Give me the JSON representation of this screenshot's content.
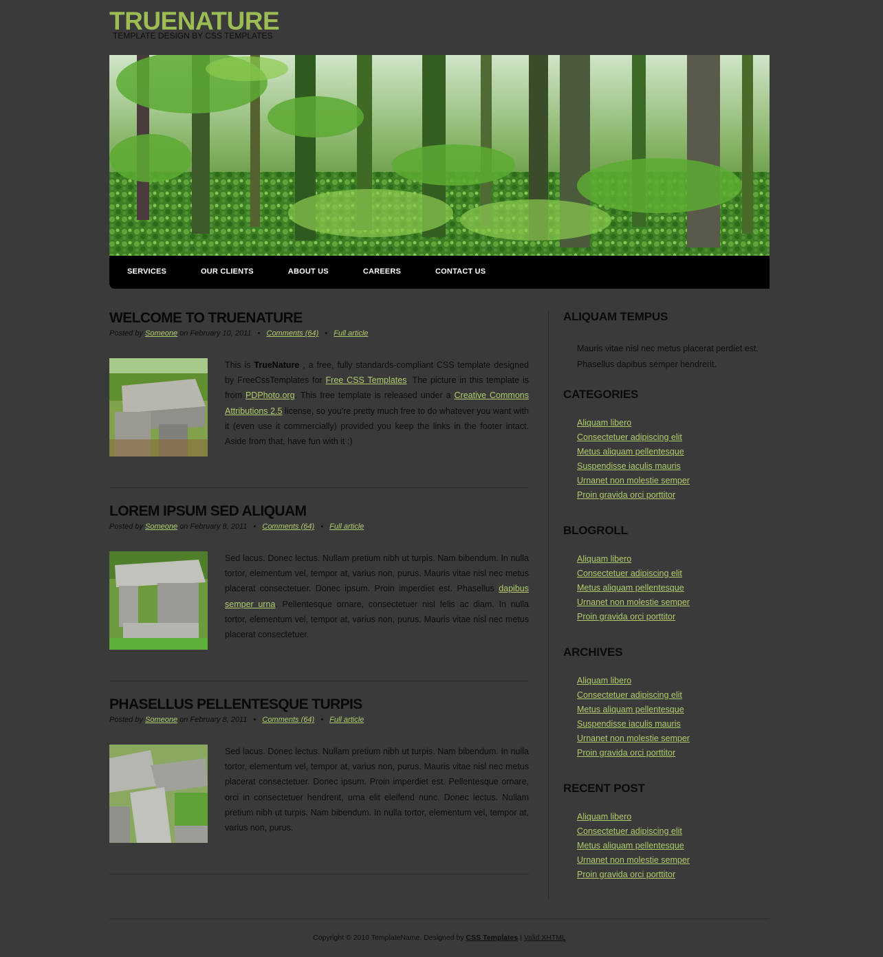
{
  "site": {
    "title": "TRUENATURE",
    "tagline": "TEMPLATE DESIGN BY CSS TEMPLATES"
  },
  "menu": [
    "SERVICES",
    "OUR CLIENTS",
    "ABOUT US",
    "CAREERS",
    "CONTACT US"
  ],
  "posts": [
    {
      "title": "WELCOME TO TRUENATURE",
      "meta": {
        "posted_by_label": "Posted by",
        "author": "Someone",
        "date": "on February 10, 2011",
        "comments": "Comments (64)",
        "full": "Full article"
      },
      "body": {
        "t1": "This is ",
        "b1": "TrueNature",
        "t2": " , a free, fully standards-compliant CSS template designed by FreeCssTemplates for ",
        "l1": "Free CSS Templates",
        "t3": ". The picture in this template is from ",
        "l2": "PDPhoto.org",
        "t4": ". This free template is released under a ",
        "l3": "Creative Commons Attributions 2.5",
        "t5": " license, so you're pretty much free to do whatever you want with it (even use it commercially) provided you keep the links in the footer intact. Aside from that, have fun with it :)"
      }
    },
    {
      "title": "LOREM IPSUM SED ALIQUAM",
      "meta": {
        "posted_by_label": "Posted by",
        "author": "Someone",
        "date": "on February 8, 2011",
        "comments": "Comments (64)",
        "full": "Full article"
      },
      "body": {
        "t1": "Sed lacus. Donec lectus. Nullam pretium nibh ut turpis. Nam bibendum. In nulla tortor, elementum vel, tempor at, varius non, purus. Mauris vitae nisl nec metus placerat consectetuer. Donec ipsum. Proin imperdiet est. Phasellus ",
        "l1": "dapibus semper urna",
        "t2": ". Pellentesque ornare, consectetuer nisl felis ac diam. In nulla tortor, elementum vel, tempor at, varius non, purus. Mauris vitae nisl nec metus placerat consectetuer."
      }
    },
    {
      "title": "PHASELLUS PELLENTESQUE TURPIS",
      "meta": {
        "posted_by_label": "Posted by",
        "author": "Someone",
        "date": "on February 8, 2011",
        "comments": "Comments (64)",
        "full": "Full article"
      },
      "body": {
        "t1": "Sed lacus. Donec lectus. Nullam pretium nibh ut turpis. Nam bibendum. In nulla tortor, elementum vel, tempor at, varius non, purus. Mauris vitae nisl nec metus placerat consectetuer. Donec ipsum. Proin imperdiet est. Pellentesque ornare, orci in consectetuer hendrerit, urna elit eleifend nunc. Donec lectus. Nullam pretium nibh ut turpis. Nam bibendum. In nulla tortor, elementum vel, tempor at, varius non, purus."
      }
    }
  ],
  "sidebar": {
    "tempus": {
      "title": "ALIQUAM TEMPUS",
      "text": "Mauris vitae nisl nec metus placerat perdiet est. Phasellus dapibus semper hendrerit."
    },
    "categories": {
      "title": "CATEGORIES",
      "items": [
        "Aliquam libero",
        "Consectetuer adipiscing elit",
        "Metus aliquam pellentesque",
        "Suspendisse iaculis mauris",
        "Urnanet non molestie semper",
        "Proin gravida orci porttitor"
      ]
    },
    "blogroll": {
      "title": "BLOGROLL",
      "items": [
        "Aliquam libero",
        "Consectetuer adipiscing elit",
        "Metus aliquam pellentesque",
        "Urnanet non molestie semper",
        "Proin gravida orci porttitor"
      ]
    },
    "archives": {
      "title": "ARCHIVES",
      "items": [
        "Aliquam libero",
        "Consectetuer adipiscing elit",
        "Metus aliquam pellentesque",
        "Suspendisse iaculis mauris",
        "Urnanet non molestie semper",
        "Proin gravida orci porttitor"
      ]
    },
    "recent": {
      "title": "RECENT POST",
      "items": [
        "Aliquam libero",
        "Consectetuer adipiscing elit",
        "Metus aliquam pellentesque",
        "Urnanet non molestie semper",
        "Proin gravida orci porttitor"
      ]
    }
  },
  "footer": {
    "text": "Copyright © 2010 TemplateName. Designed by ",
    "link1": "CSS Templates",
    "sep": " | ",
    "link2": "Valid XHTML"
  },
  "colors": {
    "background": "#3a3a3a",
    "accent": "#9cbc54",
    "link": "#b2cc6b",
    "menu": "#000000"
  }
}
